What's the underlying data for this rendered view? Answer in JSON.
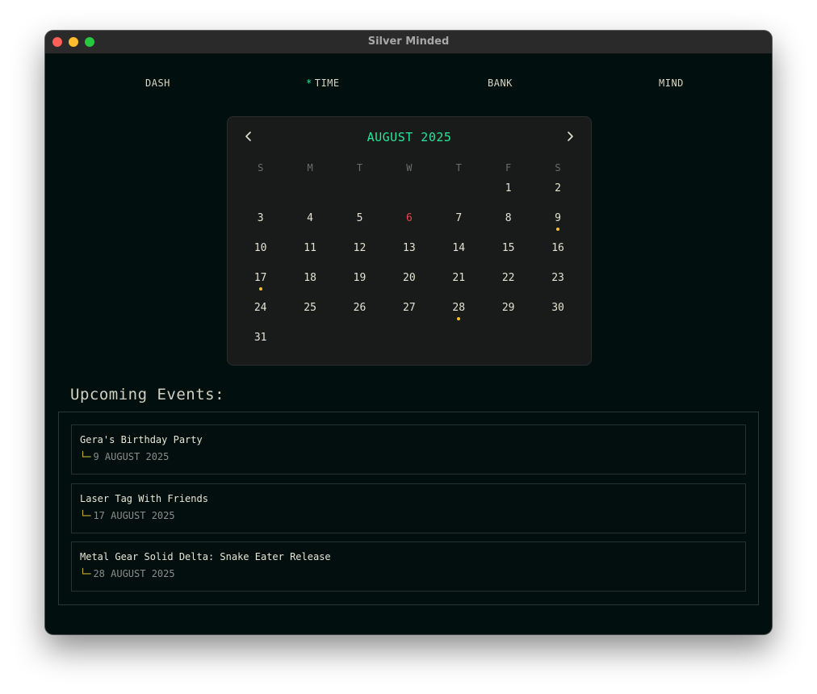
{
  "window": {
    "title": "Silver Minded"
  },
  "nav": {
    "items": [
      {
        "label": "DASH",
        "active": false
      },
      {
        "label": "TIME",
        "active": true,
        "marker": "*"
      },
      {
        "label": "BANK",
        "active": false
      },
      {
        "label": "MIND",
        "active": false
      }
    ]
  },
  "calendar": {
    "month_label": "AUGUST 2025",
    "weekdays": [
      "S",
      "M",
      "T",
      "W",
      "T",
      "F",
      "S"
    ],
    "today": 6,
    "event_days": [
      9,
      17,
      28
    ],
    "weeks": [
      [
        "",
        "",
        "",
        "",
        "",
        "1",
        "2"
      ],
      [
        "3",
        "4",
        "5",
        "6",
        "7",
        "8",
        "9"
      ],
      [
        "10",
        "11",
        "12",
        "13",
        "14",
        "15",
        "16"
      ],
      [
        "17",
        "18",
        "19",
        "20",
        "21",
        "22",
        "23"
      ],
      [
        "24",
        "25",
        "26",
        "27",
        "28",
        "29",
        "30"
      ],
      [
        "31",
        "",
        "",
        "",
        "",
        "",
        ""
      ]
    ]
  },
  "events": {
    "heading": "Upcoming Events:",
    "branch_glyph": "└─",
    "items": [
      {
        "name": "Gera's Birthday Party",
        "date": "9 AUGUST 2025"
      },
      {
        "name": "Laser Tag With Friends",
        "date": "17 AUGUST 2025"
      },
      {
        "name": "Metal Gear Solid Delta: Snake Eater Release",
        "date": "28 AUGUST 2025"
      }
    ]
  },
  "colors": {
    "accent": "#2be39a",
    "today": "#e5484d",
    "event_dot": "#f2c12e",
    "background": "#020f0f"
  }
}
